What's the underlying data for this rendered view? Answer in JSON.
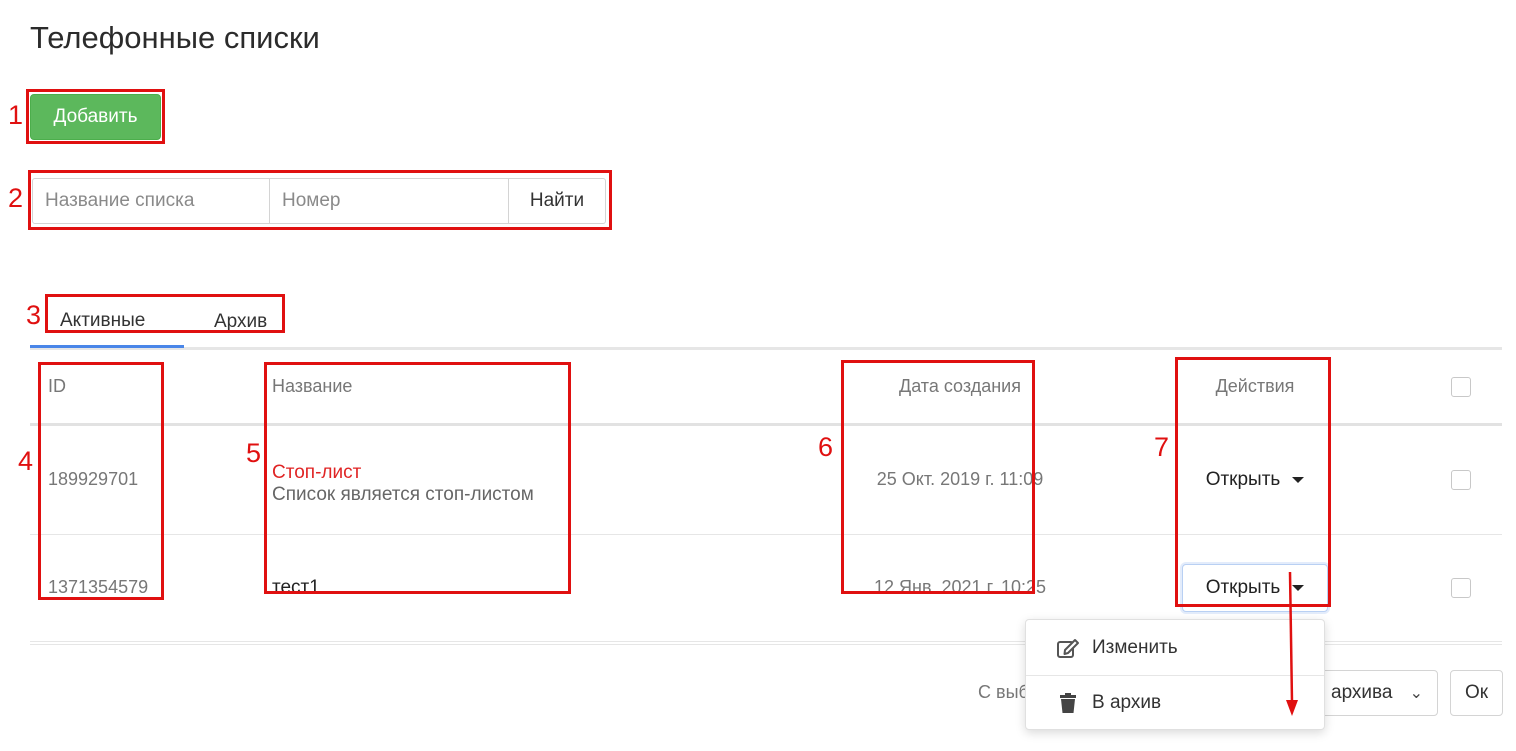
{
  "page": {
    "title": "Телефонные списки"
  },
  "toolbar": {
    "add_label": "Добавить"
  },
  "search": {
    "name_placeholder": "Название списка",
    "number_placeholder": "Номер",
    "find_label": "Найти"
  },
  "tabs": [
    {
      "label": "Активные",
      "active": true
    },
    {
      "label": "Архив",
      "active": false
    }
  ],
  "table": {
    "headers": {
      "id": "ID",
      "name": "Название",
      "date": "Дата создания",
      "actions": "Действия"
    },
    "rows": [
      {
        "id": "189929701",
        "name": "Стоп-лист",
        "description": "Список является стоп-листом",
        "date": "25 Окт. 2019 г. 11:09",
        "action_label": "Открыть"
      },
      {
        "id": "1371354579",
        "name": "тест1",
        "description": "",
        "date": "12 Янв. 2021 г. 10:25",
        "action_label": "Открыть"
      }
    ]
  },
  "dropdown": {
    "items": [
      {
        "label": "Изменить",
        "icon": "edit-icon"
      },
      {
        "label": "В архив",
        "icon": "trash-icon"
      }
    ]
  },
  "bulk": {
    "label_partial": "С выб",
    "select_value": "архива",
    "ok_label": "Ок"
  },
  "annotations": [
    "1",
    "2",
    "3",
    "4",
    "5",
    "6",
    "7"
  ],
  "colors": {
    "add_button": "#5cb85c",
    "stop_list_name": "#e02424",
    "tab_active_underline": "#4a86e8",
    "annotation": "#e01010"
  }
}
